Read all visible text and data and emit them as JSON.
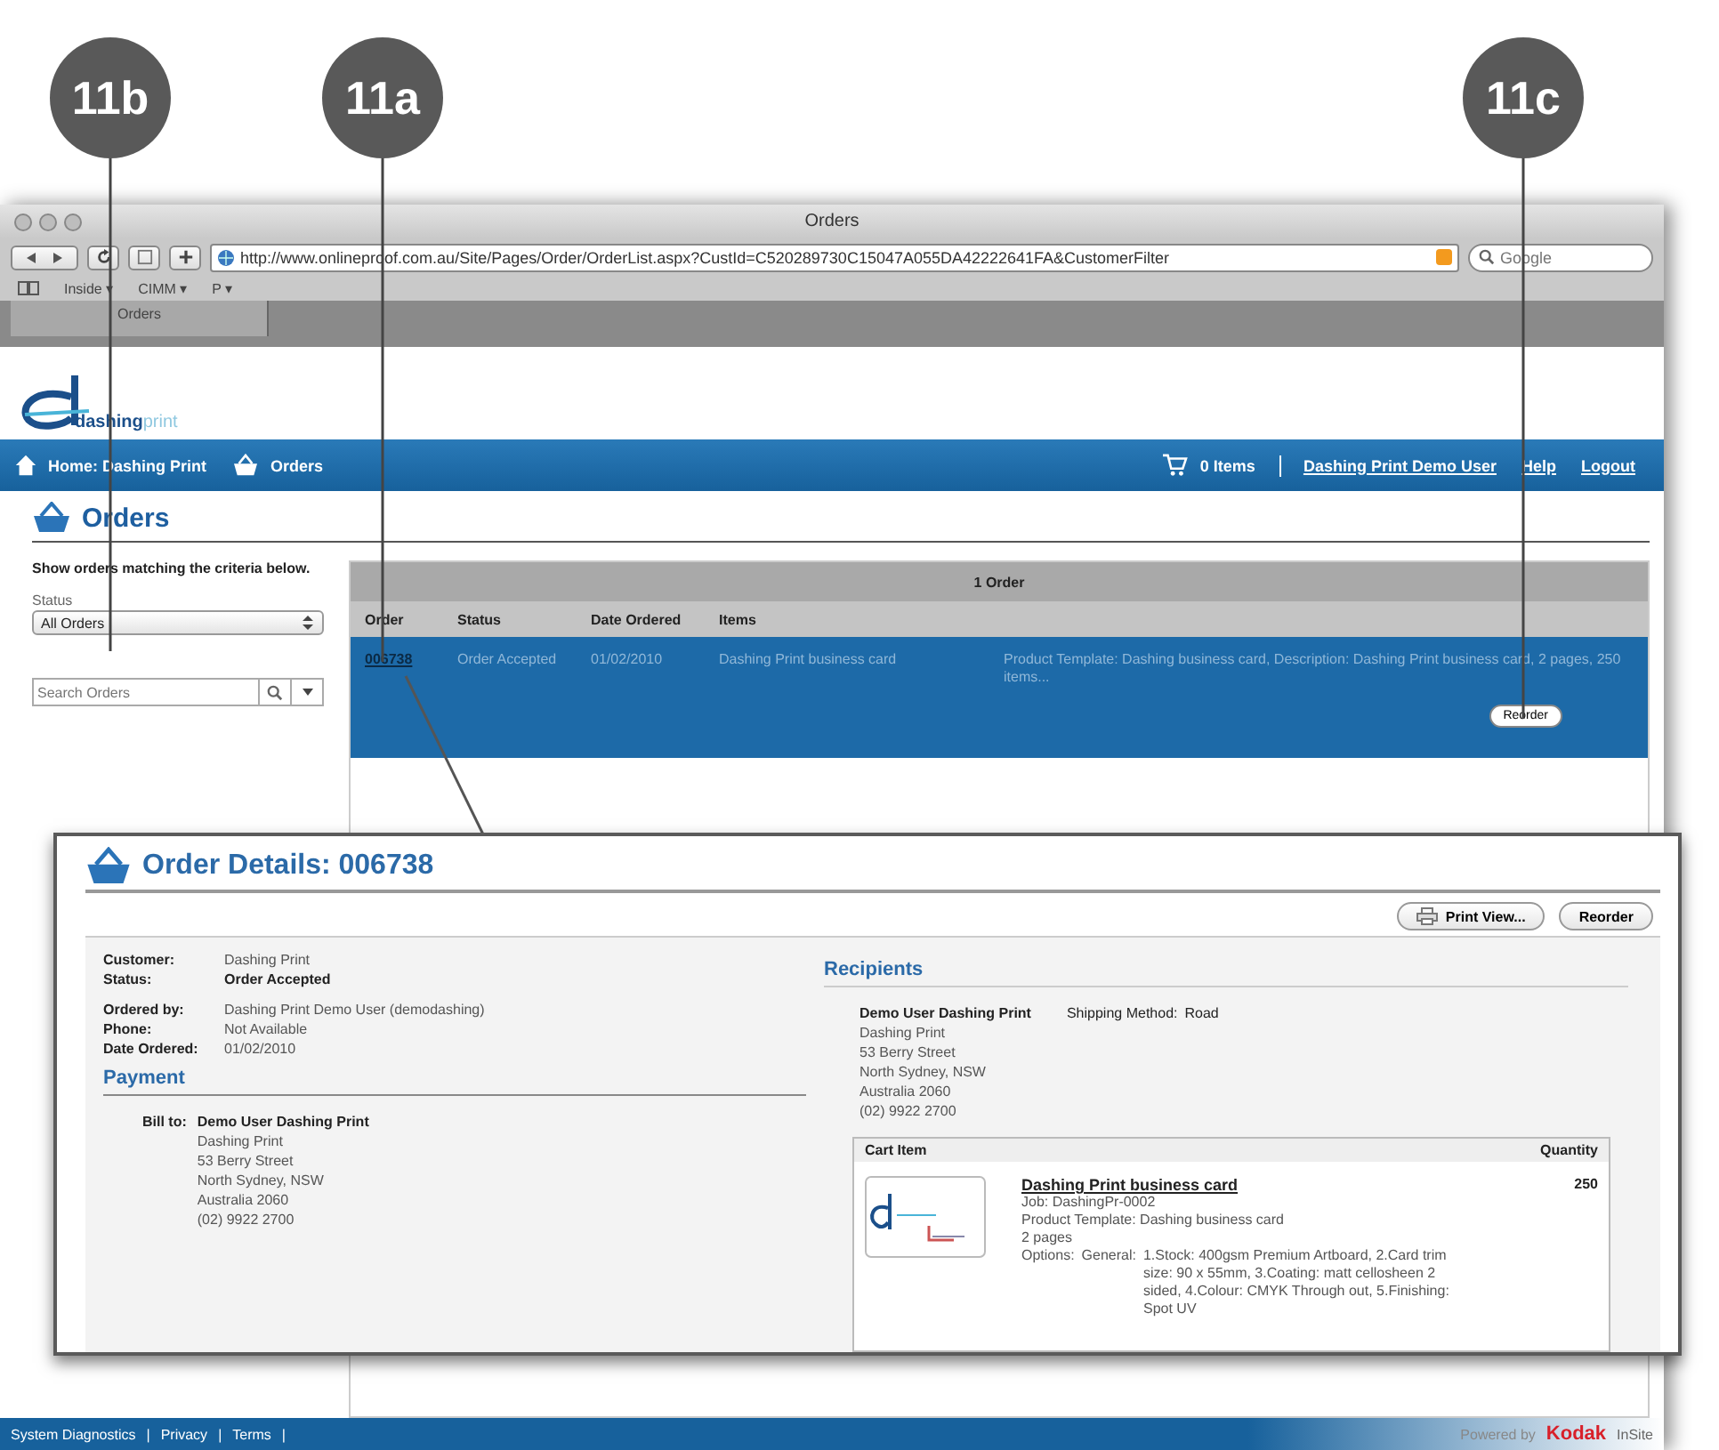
{
  "callouts": [
    {
      "label": "11b"
    },
    {
      "label": "11a"
    },
    {
      "label": "11c"
    }
  ],
  "browser": {
    "title": "Orders",
    "url": "http://www.onlineproof.com.au/Site/Pages/Order/OrderList.aspx?CustId=C520289730C15047A055DA42222641FA&CustomerFilter",
    "search_placeholder": "Google",
    "bookmarks": [
      "Inside ▾",
      "CIMM ▾",
      "P ▾"
    ],
    "tabs": [
      {
        "label": "Orders",
        "selected": true
      }
    ]
  },
  "site": {
    "logo": {
      "bold": "dashing",
      "light": "print"
    },
    "nav": {
      "left": [
        "Home: Dashing Print",
        "Orders"
      ],
      "cart": "0 Items",
      "right": [
        "Dashing Print Demo User",
        "Help",
        "Logout"
      ]
    },
    "heading": "Orders",
    "sidebar": {
      "hint": "Show orders matching the criteria below.",
      "status_label": "Status",
      "status_value": "All Orders",
      "search_placeholder": "Search Orders"
    },
    "orders": {
      "caption": "1 Order",
      "columns": [
        "Order",
        "Status",
        "Date Ordered",
        "Items"
      ],
      "rows": [
        {
          "order": "006738",
          "status": "Order Accepted",
          "date": "01/02/2010",
          "item": "Dashing Print business card",
          "description": "Product Template: Dashing business card, Description: Dashing Print business card, 2 pages, 250 items...",
          "selected": true,
          "action": "Reorder"
        }
      ]
    },
    "footer": {
      "links": [
        "System Diagnostics",
        "Privacy",
        "Terms"
      ],
      "separator": "|",
      "powered_by": "Powered by",
      "brand": "Kodak",
      "product": "InSite"
    }
  },
  "details": {
    "title": "Order Details: 006738",
    "buttons": [
      "Print View...",
      "Reorder"
    ],
    "info": [
      {
        "label": "Customer:",
        "value": "Dashing Print",
        "bold": false
      },
      {
        "label": "Status:",
        "value": "Order Accepted",
        "bold": true
      },
      {
        "label": "Ordered by:",
        "value": "Dashing Print Demo User (demodashing)",
        "bold": false
      },
      {
        "label": "Phone:",
        "value": "Not Available",
        "bold": false
      },
      {
        "label": "Date Ordered:",
        "value": "01/02/2010",
        "bold": false
      }
    ],
    "payment": {
      "heading": "Payment",
      "label": "Bill to:",
      "name": "Demo User Dashing Print",
      "lines": [
        "Dashing Print",
        "53 Berry Street",
        "North Sydney, NSW",
        "Australia 2060",
        "(02) 9922 2700"
      ]
    },
    "recipients": {
      "heading": "Recipients",
      "name": "Demo User Dashing Print",
      "lines": [
        "Dashing Print",
        "53 Berry Street",
        "North Sydney, NSW",
        "Australia 2060",
        "(02) 9922 2700"
      ],
      "shipping_label": "Shipping Method:",
      "shipping_value": "Road"
    },
    "cart": {
      "columns": [
        "Cart Item",
        "Quantity"
      ],
      "item": {
        "name": "Dashing Print business card",
        "lines": [
          "Job: DashingPr-0002",
          "Product Template: Dashing business card",
          "2 pages"
        ],
        "options_label": "Options:",
        "options_group": "General:",
        "options": "1.Stock: 400gsm Premium Artboard, 2.Card trim size: 90 x 55mm, 3.Coating: matt cellosheen 2 sided, 4.Colour: CMYK Through out, 5.Finishing: Spot UV",
        "quantity": "250"
      }
    }
  }
}
